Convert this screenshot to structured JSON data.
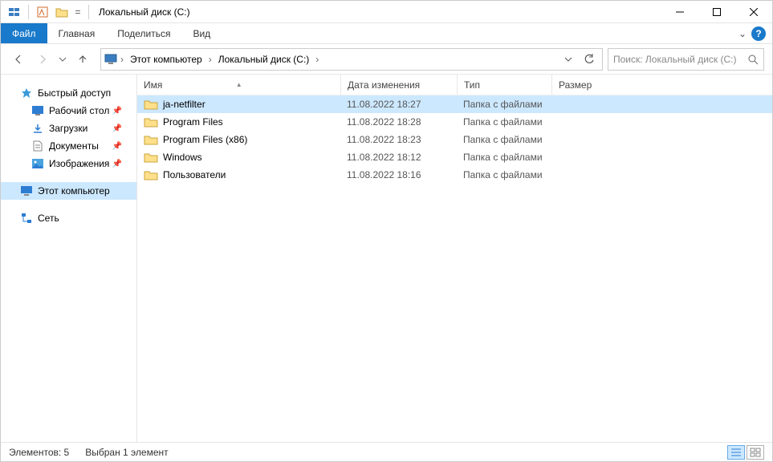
{
  "titlebar": {
    "title": "Локальный диск (C:)"
  },
  "ribbon": {
    "file": "Файл",
    "tabs": [
      "Главная",
      "Поделиться",
      "Вид"
    ]
  },
  "address": {
    "segments": [
      "Этот компьютер",
      "Локальный диск (C:)"
    ]
  },
  "search": {
    "placeholder": "Поиск: Локальный диск (C:)"
  },
  "navpane": {
    "quick_access": "Быстрый доступ",
    "items": [
      {
        "label": "Рабочий стол",
        "pinned": true
      },
      {
        "label": "Загрузки",
        "pinned": true
      },
      {
        "label": "Документы",
        "pinned": true
      },
      {
        "label": "Изображения",
        "pinned": true
      }
    ],
    "this_pc": "Этот компьютер",
    "network": "Сеть"
  },
  "columns": {
    "name": "Имя",
    "date": "Дата изменения",
    "type": "Тип",
    "size": "Размер"
  },
  "rows": [
    {
      "name": "ja-netfilter",
      "date": "11.08.2022 18:27",
      "type": "Папка с файлами",
      "selected": true
    },
    {
      "name": "Program Files",
      "date": "11.08.2022 18:28",
      "type": "Папка с файлами",
      "selected": false
    },
    {
      "name": "Program Files (x86)",
      "date": "11.08.2022 18:23",
      "type": "Папка с файлами",
      "selected": false
    },
    {
      "name": "Windows",
      "date": "11.08.2022 18:12",
      "type": "Папка с файлами",
      "selected": false
    },
    {
      "name": "Пользователи",
      "date": "11.08.2022 18:16",
      "type": "Папка с файлами",
      "selected": false
    }
  ],
  "status": {
    "count": "Элементов: 5",
    "selection": "Выбран 1 элемент"
  }
}
